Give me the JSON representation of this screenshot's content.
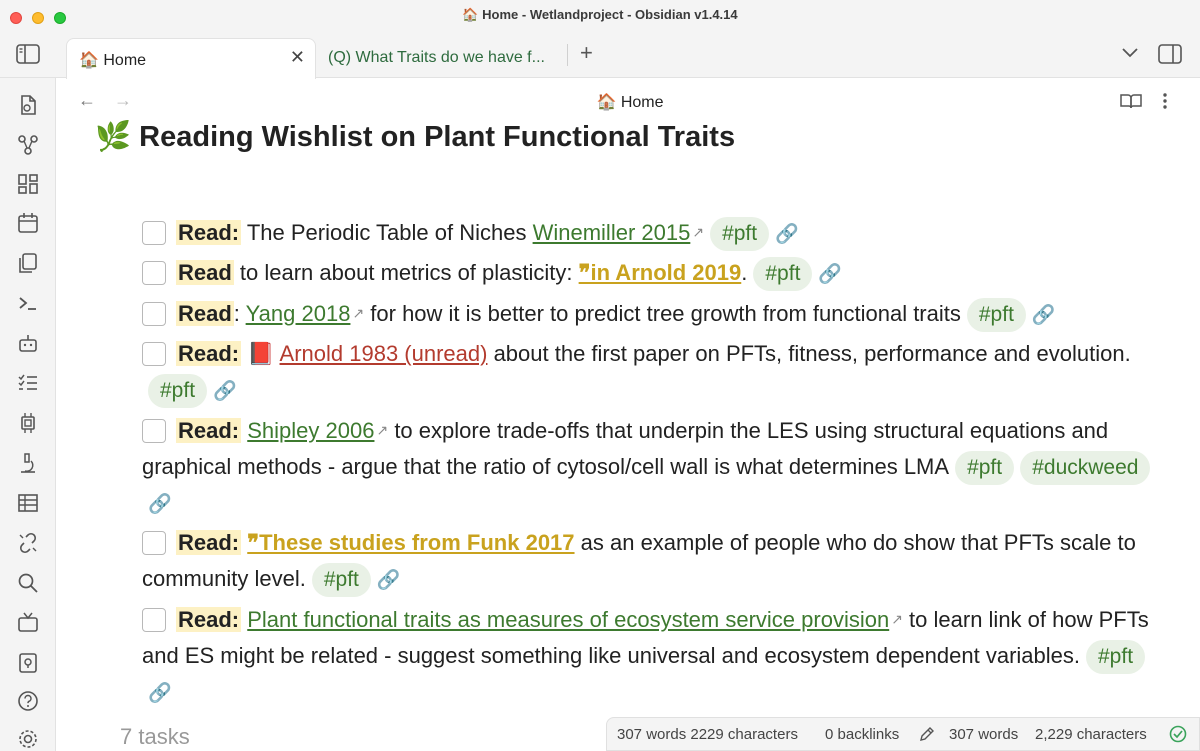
{
  "window": {
    "title": "🏠 Home - Wetlandproject - Obsidian v1.4.14"
  },
  "tabs": [
    {
      "label": "🏠 Home"
    },
    {
      "label": "(Q) What Traits do we have f..."
    }
  ],
  "view": {
    "title": "🏠 Home"
  },
  "note": {
    "heading": "🌿 Reading Wishlist on Plant Functional Traits",
    "tasks": [
      {
        "read": "Read:",
        "t1": " The Periodic Table of Niches ",
        "link": "Winemiller 2015",
        "tag": "#pft"
      },
      {
        "read": "Read",
        "t1": " to learn about metrics of plasticity: ",
        "link": "❞in Arnold 2019",
        "t2": ".",
        "tag": "#pft"
      },
      {
        "read": "Read",
        "t0": ": ",
        "link": "Yang 2018",
        "t2": " for how it is better to predict tree growth from functional traits",
        "tag": "#pft"
      },
      {
        "read": "Read:",
        "t1": " 📕 ",
        "link": "Arnold 1983 (unread)",
        "t2": " about the first paper on PFTs, fitness, performance and evolution.",
        "tag": "#pft"
      },
      {
        "read": "Read:",
        "t1": " ",
        "link": "Shipley 2006",
        "t2": " to explore trade-offs that underpin the LES using structural equations and graphical methods - argue that the ratio of cytosol/cell wall is what determines LMA",
        "tag": "#pft",
        "tag2": "#duckweed"
      },
      {
        "read": "Read:",
        "t1": " ",
        "link": "❞These studies from Funk 2017",
        "t2": " as an example of people who do show that PFTs scale to community level.",
        "tag": "#pft"
      },
      {
        "read": "Read:",
        "t1": " ",
        "link": "Plant functional traits as measures of ecosystem service provision",
        "t2": " to learn link of how PFTs and ES might be related - suggest something like universal and ecosystem dependent variables.",
        "tag": "#pft"
      }
    ],
    "task_count": "7 tasks"
  },
  "status": {
    "words_chars": "307 words 2229 characters",
    "backlinks": "0 backlinks",
    "words": "307 words",
    "characters": "2,229 characters"
  },
  "icons": {
    "external": "↗",
    "chain": "🔗",
    "close": "✕",
    "plus": "+",
    "chevron": "⌄",
    "back": "←",
    "forward": "→"
  },
  "colors": {
    "tag_bg": "#e9f1e6",
    "tag_text": "#3d7a2f",
    "highlight": "#fdf1c4",
    "link_red": "#b33b2e",
    "link_yellow": "#c9a21e"
  }
}
